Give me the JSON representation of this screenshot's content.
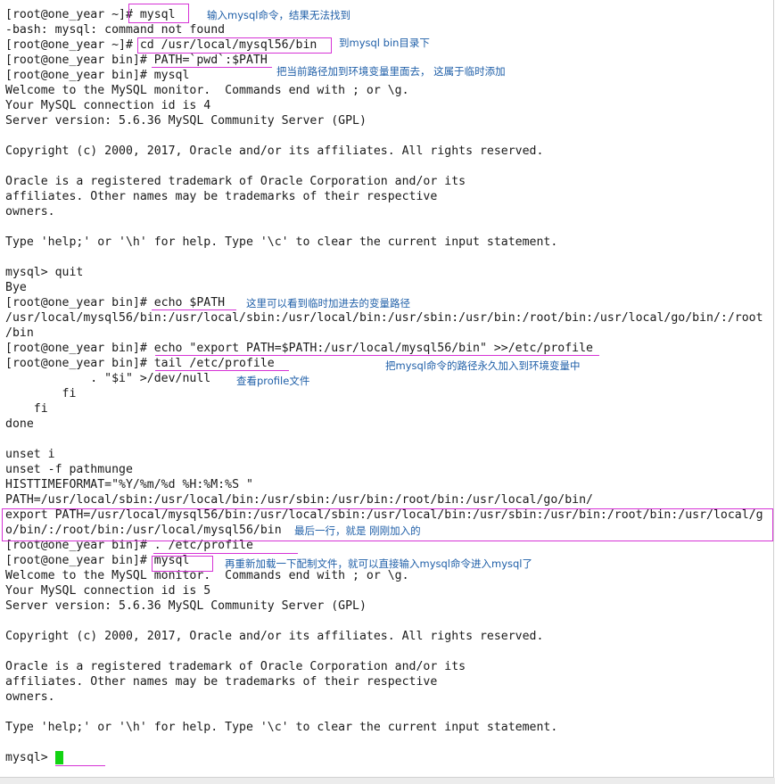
{
  "terminal": {
    "lines": [
      "[root@one_year ~]# mysql",
      "-bash: mysql: command not found",
      "[root@one_year ~]# cd /usr/local/mysql56/bin",
      "[root@one_year bin]# PATH=`pwd`:$PATH",
      "[root@one_year bin]# mysql",
      "Welcome to the MySQL monitor.  Commands end with ; or \\g.",
      "Your MySQL connection id is 4",
      "Server version: 5.6.36 MySQL Community Server (GPL)",
      "",
      "Copyright (c) 2000, 2017, Oracle and/or its affiliates. All rights reserved.",
      "",
      "Oracle is a registered trademark of Oracle Corporation and/or its",
      "affiliates. Other names may be trademarks of their respective",
      "owners.",
      "",
      "Type 'help;' or '\\h' for help. Type '\\c' to clear the current input statement.",
      "",
      "mysql> quit",
      "Bye",
      "[root@one_year bin]# echo $PATH",
      "/usr/local/mysql56/bin:/usr/local/sbin:/usr/local/bin:/usr/sbin:/usr/bin:/root/bin:/usr/local/go/bin/:/root",
      "/bin",
      "[root@one_year bin]# echo \"export PATH=$PATH:/usr/local/mysql56/bin\" >>/etc/profile",
      "[root@one_year bin]# tail /etc/profile",
      "            . \"$i\" >/dev/null",
      "        fi",
      "    fi",
      "done",
      "",
      "unset i",
      "unset -f pathmunge",
      "HISTTIMEFORMAT=\"%Y/%m/%d %H:%M:%S \"",
      "PATH=/usr/local/sbin:/usr/local/bin:/usr/sbin:/usr/bin:/root/bin:/usr/local/go/bin/",
      "export PATH=/usr/local/mysql56/bin:/usr/local/sbin:/usr/local/bin:/usr/sbin:/usr/bin:/root/bin:/usr/local/g",
      "o/bin/:/root/bin:/usr/local/mysql56/bin",
      "[root@one_year bin]# . /etc/profile",
      "[root@one_year bin]# mysql",
      "Welcome to the MySQL monitor.  Commands end with ; or \\g.",
      "Your MySQL connection id is 5",
      "Server version: 5.6.36 MySQL Community Server (GPL)",
      "",
      "Copyright (c) 2000, 2017, Oracle and/or its affiliates. All rights reserved.",
      "",
      "Oracle is a registered trademark of Oracle Corporation and/or its",
      "affiliates. Other names may be trademarks of their respective",
      "owners.",
      "",
      "Type 'help;' or '\\h' for help. Type '\\c' to clear the current input statement.",
      "",
      "mysql> "
    ]
  },
  "annotations": {
    "mysql_not_found": "输入mysql命令，结果无法找到",
    "to_bin_dir": "到mysql bin目录下",
    "temp_path": "把当前路径加到环境变量里面去， 这属于临时添加",
    "see_path": "这里可以看到临时加进去的变量路径",
    "permanent_path": "把mysql命令的路径永久加入到环境变量中",
    "view_profile": "查看profile文件",
    "last_line": "最后一行，就是 刚刚加入的",
    "reload_profile": "再重新加载一下配制文件，就可以直接输入mysql命令进入mysql了"
  },
  "colors": {
    "annotation_text": "#1f5fa8",
    "highlight_box": "#d633d6",
    "cursor": "#12d312",
    "terminal_text": "#1a1a1a"
  },
  "status_bar": {
    "text": ""
  }
}
